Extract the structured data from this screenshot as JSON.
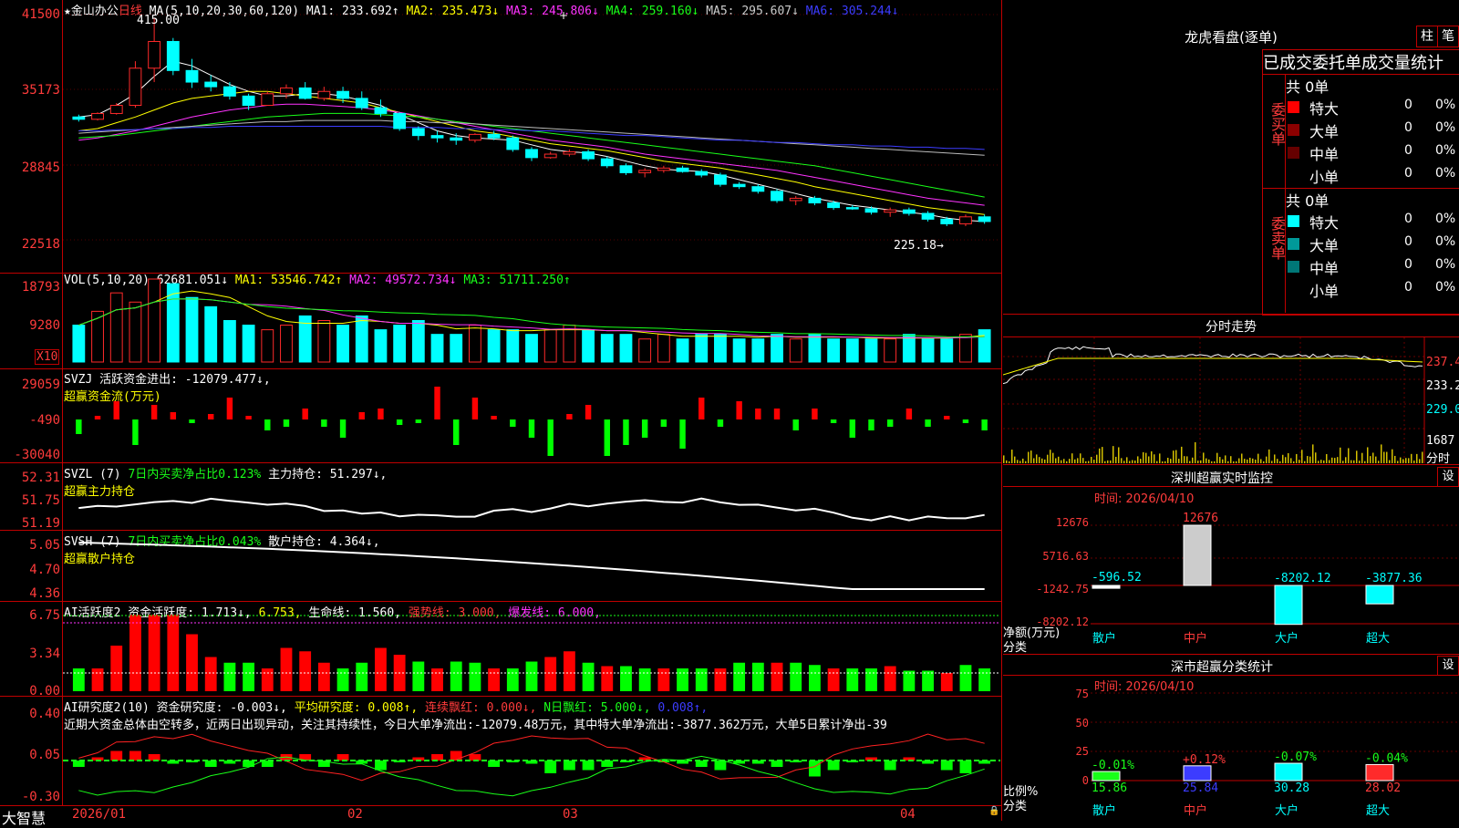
{
  "main_chart": {
    "title": "★金山办公",
    "period": "日线",
    "ma_label": "MA(5,10,20,30,60,120)",
    "ma1": "MA1: 233.692↑",
    "ma2": "MA2: 235.473↓",
    "ma3": "MA3: 245.806↓",
    "ma4": "MA4: 259.160↓",
    "ma5": "MA5: 295.607↓",
    "ma6": "MA6: 305.244↓",
    "high_label": "415.00",
    "low_label": "225.18→",
    "y_axis": [
      "41500",
      "35173",
      "28845",
      "22518"
    ]
  },
  "vol_panel": {
    "header": "VOL(5,10,20)",
    "value": "62681.051↓",
    "ma1": "MA1: 53546.742↑",
    "ma2": "MA2: 49572.734↓",
    "ma3": "MA3: 51711.250↑",
    "y_axis": [
      "18793",
      "9280"
    ],
    "unit": "X10"
  },
  "svzj_panel": {
    "header": "SVZJ  活跃资金进出: -12079.477↓,",
    "subtitle": "超赢资金流(万元)",
    "y_axis": [
      "29059",
      "-490",
      "-30040"
    ]
  },
  "svzl_panel": {
    "header_a": "SVZL (7)",
    "header_b": "7日内买卖净占比0.123%",
    "header_c": "主力持仓: 51.297↓,",
    "subtitle": "超赢主力持仓",
    "y_axis": [
      "52.31",
      "51.75",
      "51.19"
    ]
  },
  "svsh_panel": {
    "header_a": "SVSH (7)",
    "header_b": "7日内买卖净占比0.043%",
    "header_c": "散户持仓: 4.364↓,",
    "subtitle": "超赢散户持仓",
    "y_axis": [
      "5.05",
      "4.70",
      "4.36"
    ]
  },
  "ai_active_panel": {
    "header_a": "AI活跃度2 资金活跃度: 1.713↓,",
    "header_b": "6.753,",
    "header_c": "生命线: 1.560,",
    "header_d": "强势线: 3.000,",
    "header_e": "爆发线: 6.000,",
    "y_axis": [
      "6.75",
      "3.34",
      "0.00"
    ]
  },
  "ai_research_panel": {
    "header_a": "AI研究度2(10) 资金研究度: -0.003↓,",
    "header_b": "平均研究度: 0.008↑,",
    "header_c": "连续飘红: 0.000↓,",
    "header_d": "N日飘红: 5.000↓,",
    "header_e": "0.008↑,",
    "comment": "近期大资金总体由空转多，近两日出现异动，关注其持续性，今日大单净流出:-12079.48万元，其中特大单净流出:-3877.362万元，大单5日累计净出-39",
    "y_axis": [
      "0.40",
      "0.05",
      "-0.30"
    ]
  },
  "x_axis": {
    "brand": "大智慧",
    "labels": [
      "2026/01",
      "02",
      "03",
      "04"
    ]
  },
  "right_panel": {
    "dragon_title": "龙虎看盘(逐单)",
    "btn_column": "柱",
    "btn_stroke": "笔",
    "stats_title": "已成交委托单成交量统计",
    "buy_label": "委买单",
    "sell_label": "委卖单",
    "buy_total": "共 0单",
    "sell_total": "共 0单",
    "buy_rows": [
      {
        "name": "特大",
        "count": "0",
        "pct": "0%",
        "color": "#ff0000"
      },
      {
        "name": "大单",
        "count": "0",
        "pct": "0%",
        "color": "#8b0000"
      },
      {
        "name": "中单",
        "count": "0",
        "pct": "0%",
        "color": "#660000"
      },
      {
        "name": "小单",
        "count": "0",
        "pct": "0%",
        "color": ""
      }
    ],
    "sell_rows": [
      {
        "name": "特大",
        "count": "0",
        "pct": "0%",
        "color": "#00ffff"
      },
      {
        "name": "大单",
        "count": "0",
        "pct": "0%",
        "color": "#009999"
      },
      {
        "name": "中单",
        "count": "0",
        "pct": "0%",
        "color": "#007777"
      },
      {
        "name": "小单",
        "count": "0",
        "pct": "0%",
        "color": ""
      }
    ],
    "intraday_title": "分时走势",
    "intraday_y": [
      "237.4",
      "233.2",
      "229.0",
      "1687"
    ],
    "intraday_unit": "分时",
    "sz_monitor_title": "深圳超赢实时监控",
    "sz_monitor_btn": "设",
    "sz_monitor_time": "时间: 2026/04/10",
    "sz_monitor_y": [
      "12676",
      "5716.63",
      "-1242.75",
      "-8202.12"
    ],
    "sz_monitor_values": [
      "-596.52",
      "12676",
      "-8202.12",
      "-3877.36"
    ],
    "sz_monitor_unit": "净额(万元)",
    "sz_monitor_cat": "分类",
    "categories": [
      "散户",
      "中户",
      "大户",
      "超大"
    ],
    "sz_class_title": "深市超赢分类统计",
    "sz_class_btn": "设",
    "sz_class_time": "时间: 2026/04/10",
    "sz_class_y": [
      "75",
      "50",
      "25",
      "0"
    ],
    "sz_class_changes": [
      "-0.01%",
      "+0.12%",
      "-0.07%",
      "-0.04%"
    ],
    "sz_class_values": [
      "15.86",
      "25.84",
      "30.28",
      "28.02"
    ],
    "sz_class_unit": "比例%",
    "sz_class_cat": "分类"
  },
  "chart_data": {
    "type": "candlestick",
    "note_series": "daily K-line with MA lines, volume and indicator panels",
    "candles": [
      [
        330,
        332,
        326,
        328
      ],
      [
        328,
        334,
        327,
        333
      ],
      [
        333,
        342,
        332,
        340
      ],
      [
        340,
        378,
        338,
        372
      ],
      [
        372,
        415,
        360,
        395
      ],
      [
        395,
        398,
        366,
        370
      ],
      [
        370,
        380,
        355,
        360
      ],
      [
        360,
        366,
        352,
        356
      ],
      [
        356,
        360,
        345,
        348
      ],
      [
        348,
        350,
        336,
        340
      ],
      [
        340,
        352,
        340,
        350
      ],
      [
        350,
        358,
        346,
        355
      ],
      [
        355,
        360,
        345,
        346
      ],
      [
        346,
        356,
        344,
        352
      ],
      [
        352,
        356,
        342,
        346
      ],
      [
        346,
        352,
        336,
        338
      ],
      [
        338,
        345,
        330,
        333
      ],
      [
        333,
        334,
        318,
        320
      ],
      [
        320,
        322,
        310,
        314
      ],
      [
        314,
        318,
        308,
        312
      ],
      [
        312,
        316,
        306,
        310
      ],
      [
        310,
        316,
        308,
        315
      ],
      [
        315,
        318,
        310,
        312
      ],
      [
        312,
        314,
        300,
        302
      ],
      [
        302,
        304,
        292,
        295
      ],
      [
        295,
        300,
        294,
        298
      ],
      [
        298,
        302,
        296,
        300
      ],
      [
        300,
        302,
        292,
        294
      ],
      [
        294,
        296,
        286,
        288
      ],
      [
        288,
        290,
        280,
        282
      ],
      [
        282,
        286,
        278,
        284
      ],
      [
        284,
        288,
        282,
        286
      ],
      [
        286,
        288,
        282,
        283
      ],
      [
        283,
        285,
        278,
        280
      ],
      [
        280,
        282,
        270,
        272
      ],
      [
        272,
        274,
        268,
        270
      ],
      [
        270,
        272,
        264,
        266
      ],
      [
        266,
        268,
        256,
        258
      ],
      [
        258,
        262,
        254,
        260
      ],
      [
        260,
        262,
        254,
        256
      ],
      [
        256,
        258,
        250,
        252
      ],
      [
        252,
        254,
        250,
        251
      ],
      [
        251,
        253,
        246,
        248
      ],
      [
        248,
        252,
        244,
        250
      ],
      [
        250,
        252,
        245,
        247
      ],
      [
        247,
        249,
        240,
        242
      ],
      [
        242,
        244,
        236,
        238
      ],
      [
        238,
        246,
        236,
        244
      ],
      [
        244,
        246,
        238,
        240
      ]
    ],
    "ma_lines": {
      "MA1": [
        330,
        332,
        340,
        350,
        365,
        378,
        374,
        366,
        358,
        352,
        348,
        348,
        350,
        350,
        348,
        344,
        340,
        332,
        325,
        318,
        314,
        312,
        311,
        310,
        306,
        302,
        300,
        299,
        296,
        292,
        288,
        285,
        284,
        283,
        280,
        276,
        272,
        268,
        264,
        260,
        257,
        254,
        252,
        250,
        248,
        246,
        243,
        241,
        240
      ],
      "MA2": [
        318,
        320,
        325,
        330,
        336,
        342,
        346,
        348,
        350,
        352,
        352,
        350,
        348,
        346,
        344,
        342,
        338,
        334,
        330,
        326,
        322,
        318,
        316,
        313,
        310,
        307,
        305,
        303,
        301,
        298,
        295,
        292,
        290,
        288,
        286,
        283,
        280,
        277,
        274,
        270,
        267,
        264,
        261,
        258,
        255,
        252,
        250,
        248,
        246
      ],
      "MA3": [
        310,
        312,
        315,
        318,
        322,
        326,
        330,
        333,
        336,
        338,
        340,
        341,
        341,
        340,
        339,
        338,
        336,
        334,
        331,
        328,
        325,
        322,
        319,
        316,
        313,
        310,
        308,
        306,
        304,
        301,
        298,
        296,
        294,
        292,
        290,
        288,
        286,
        284,
        281,
        278,
        275,
        272,
        269,
        266,
        263,
        260,
        258,
        256,
        254
      ],
      "MA4": [
        312,
        313,
        314,
        316,
        318,
        320,
        322,
        324,
        326,
        328,
        330,
        331,
        332,
        333,
        333,
        333,
        332,
        331,
        330,
        328,
        326,
        324,
        322,
        320,
        318,
        316,
        314,
        312,
        310,
        308,
        306,
        304,
        302,
        300,
        298,
        296,
        294,
        292,
        290,
        288,
        285,
        282,
        279,
        276,
        273,
        270,
        267,
        264,
        261
      ],
      "MA5": [
        316,
        317,
        318,
        319,
        320,
        321,
        322,
        323,
        324,
        325,
        326,
        326,
        327,
        327,
        327,
        327,
        327,
        326,
        326,
        325,
        325,
        324,
        323,
        322,
        321,
        320,
        319,
        318,
        317,
        316,
        315,
        314,
        313,
        312,
        311,
        310,
        309,
        308,
        307,
        306,
        305,
        304,
        303,
        302,
        301,
        300,
        299,
        298,
        297
      ],
      "MA6": [
        318,
        318,
        319,
        319,
        320,
        320,
        321,
        321,
        322,
        322,
        322,
        322,
        322,
        322,
        322,
        322,
        322,
        321,
        321,
        321,
        320,
        320,
        319,
        319,
        318,
        318,
        317,
        316,
        315,
        314,
        314,
        313,
        312,
        311,
        310,
        310,
        309,
        308,
        308,
        307,
        306,
        306,
        305,
        305,
        304,
        304,
        303,
        303,
        302
      ]
    },
    "volume": [
      8,
      11,
      15,
      13,
      18,
      17,
      14,
      12,
      9,
      8,
      7,
      8,
      10,
      9,
      8,
      10,
      7,
      8,
      9,
      6,
      6,
      8,
      7,
      7,
      6,
      7,
      8,
      7,
      6,
      6,
      5,
      6,
      5,
      6,
      6,
      5,
      5,
      6,
      5,
      6,
      5,
      5,
      5,
      5,
      6,
      5,
      5,
      6,
      7
    ],
    "xlabels": [
      "2026/01",
      "02",
      "03",
      "04"
    ],
    "ylim": [
      225.18,
      415.0
    ]
  }
}
